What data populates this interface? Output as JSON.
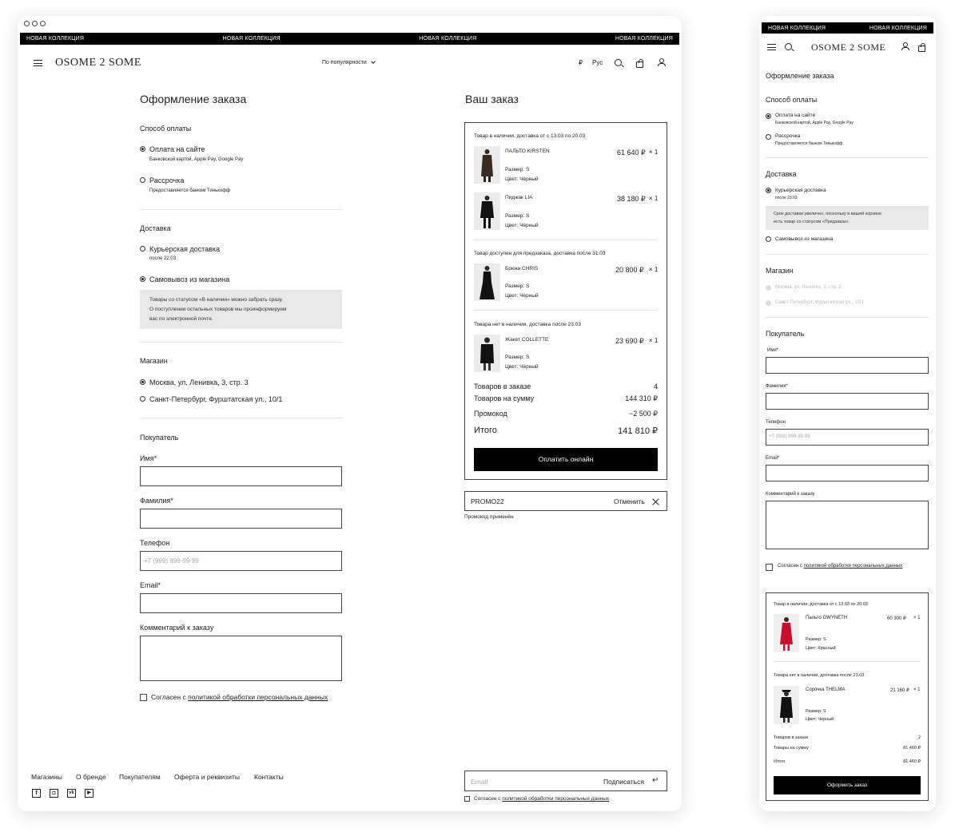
{
  "ticker": "Новая коллекция",
  "header": {
    "logo": "OSOME 2 SOME",
    "sort": "По популярности",
    "currency": "₽",
    "lang": "Рус"
  },
  "checkout": {
    "title": "Оформление заказа",
    "payment": {
      "title": "Способ оплаты",
      "options": [
        {
          "label": "Оплата на сайте",
          "sub": "Банковской картой, Apple Pay, Google Pay"
        },
        {
          "label": "Рассрочка",
          "sub": "Предоставляется банком Тинькофф"
        }
      ]
    },
    "delivery": {
      "title": "Доставка",
      "courier": "Курьерская доставка",
      "courier_desk_sub": "после 22.03",
      "courier_mob_sub": "после 23.03",
      "pickup": "Самовывоз из магазина",
      "desk_note": [
        "Товары со статусом «В наличии» можно забрать сразу.",
        "О поступлении остальных товаров мы проинформируем",
        "вас по электронной почте."
      ],
      "mob_note": [
        "Срок доставки увеличен, поскольку в вашей корзине",
        "есть товар со статусом «Предзаказ»."
      ]
    },
    "store": {
      "title": "Магазин",
      "options": [
        "Москва, ул. Ленивка, 3, стр. 3",
        "Санкт-Петербург, Фурштатская ул., 10/1"
      ]
    },
    "buyer": {
      "title": "Покупатель",
      "name": "Имя*",
      "surname": "Фамилия*",
      "phone": "Телефон",
      "phone_ph": "+7 (999) 999-99-99",
      "email": "Email*",
      "comment": "Комментарий к заказу"
    },
    "consent_prefix": "Согласен с ",
    "consent_link": "политикой обработки персональных данных"
  },
  "order": {
    "title": "Ваш заказ",
    "groups": [
      {
        "heading": "Товар в наличии, доставка от с 13.03 по 20.03",
        "items": [
          {
            "name": "ПАЛЬТО KIRSTEN",
            "price": "61 640 ₽",
            "qty": "× 1",
            "size": "Размер: S",
            "color": "Цвет: Чёрный"
          },
          {
            "name": "Пиджак LIA",
            "price": "38 180 ₽",
            "qty": "× 1",
            "size": "Размер: S",
            "color": "Цвет: Чёрный"
          }
        ]
      },
      {
        "heading": "Товар доступен для предзаказа, доставка после 31.03",
        "items": [
          {
            "name": "Брюки CHRIS",
            "price": "20 800 ₽",
            "qty": "× 1",
            "size": "Размер: S",
            "color": "Цвет: Чёрный"
          }
        ]
      },
      {
        "heading": "Товара нет в наличии, доставка после 23.03",
        "items": [
          {
            "name": "Жакет COLLETTE",
            "price": "23 690 ₽",
            "qty": "× 1",
            "size": "Размер: S",
            "color": "Цвет: Чёрный"
          }
        ]
      }
    ],
    "totals": [
      {
        "label": "Товаров в заказе",
        "value": "4"
      },
      {
        "label": "Товаров на сумму",
        "value": "144 310 ₽"
      },
      {
        "label": "Промокод",
        "value": "−2 500 ₽"
      }
    ],
    "grand_label": "Итого",
    "grand_value": "141 810 ₽",
    "pay_button": "Оплатить онлайн",
    "promo_code": "PROMO22",
    "promo_cancel": "Отменить",
    "promo_status": "Промокод применён"
  },
  "mobile_order": {
    "groups": [
      {
        "heading": "Товар в наличии, доставка от с 13.03 по 20.03",
        "item": {
          "name": "Пальто GWYNETH",
          "price": "60 300 ₽",
          "qty": "× 1",
          "size": "Размер: S",
          "color": "Цвет: Красный"
        }
      },
      {
        "heading": "Товара нет в наличии, доставка после 23.03",
        "item": {
          "name": "Сорочка THELMA",
          "price": "21 160 ₽",
          "qty": "× 1",
          "size": "Размер: S",
          "color": "Цвет: Черный"
        }
      }
    ],
    "totals": [
      {
        "label": "Товаров в заказе",
        "value": "2"
      },
      {
        "label": "Товары на сумму",
        "value": "81 460 ₽"
      },
      {
        "label": "Итого",
        "value": "81 460 ₽"
      }
    ],
    "button": "Оформить заказ"
  },
  "footer": {
    "links": [
      "Магазины",
      "О бренде",
      "Покупателям",
      "Оферта и реквизиты",
      "Контакты"
    ],
    "social": [
      {
        "icon": "facebook-icon",
        "glyph": "f"
      },
      {
        "icon": "instagram-icon",
        "glyph": "◘"
      },
      {
        "icon": "vk-icon",
        "glyph": "vk"
      },
      {
        "icon": "youtube-icon",
        "glyph": "▶"
      }
    ],
    "email_ph": "Email",
    "subscribe": "Подписаться"
  },
  "colors": {
    "accent": "#000000",
    "note_bg": "#e8e8e8",
    "red_coat": "#c8102e"
  }
}
